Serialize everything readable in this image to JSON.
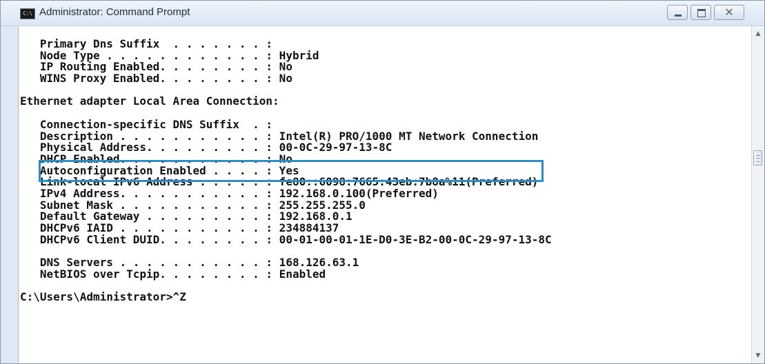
{
  "window": {
    "title": "Administrator: Command Prompt",
    "icon_text": "C:\\",
    "controls": {
      "minimize": "minimize-icon",
      "maximize": "maximize-icon",
      "close": "✕"
    }
  },
  "console": {
    "lines": [
      "   Primary Dns Suffix  . . . . . . . :",
      "   Node Type . . . . . . . . . . . . : Hybrid",
      "   IP Routing Enabled. . . . . . . . : No",
      "   WINS Proxy Enabled. . . . . . . . : No",
      "",
      "Ethernet adapter Local Area Connection:",
      "",
      "   Connection-specific DNS Suffix  . :",
      "   Description . . . . . . . . . . . : Intel(R) PRO/1000 MT Network Connection",
      "   Physical Address. . . . . . . . . : 00-0C-29-97-13-8C",
      "   DHCP Enabled. . . . . . . . . . . : No",
      "   Autoconfiguration Enabled . . . . : Yes",
      "   Link-local IPv6 Address . . . . . : fe80::6098:7665:43eb:7b8a%11(Preferred)",
      "   IPv4 Address. . . . . . . . . . . : 192.168.0.100(Preferred)",
      "   Subnet Mask . . . . . . . . . . . : 255.255.255.0",
      "   Default Gateway . . . . . . . . . : 192.168.0.1",
      "   DHCPv6 IAID . . . . . . . . . . . : 234884137",
      "   DHCPv6 Client DUID. . . . . . . . : 00-01-00-01-1E-D0-3E-B2-00-0C-29-97-13-8C",
      "",
      "   DNS Servers . . . . . . . . . . . : 168.126.63.1",
      "   NetBIOS over Tcpip. . . . . . . . : Enabled",
      "",
      "C:\\Users\\Administrator>^Z"
    ],
    "highlighted_line": "   Physical Address. . . . . . . . . : 00-0C-29-97-13-8C"
  },
  "colors": {
    "highlight_border": "#2a8fc7",
    "console_bg": "#ffffff",
    "console_text": "#111111",
    "titlebar": "#dbe6f3"
  }
}
